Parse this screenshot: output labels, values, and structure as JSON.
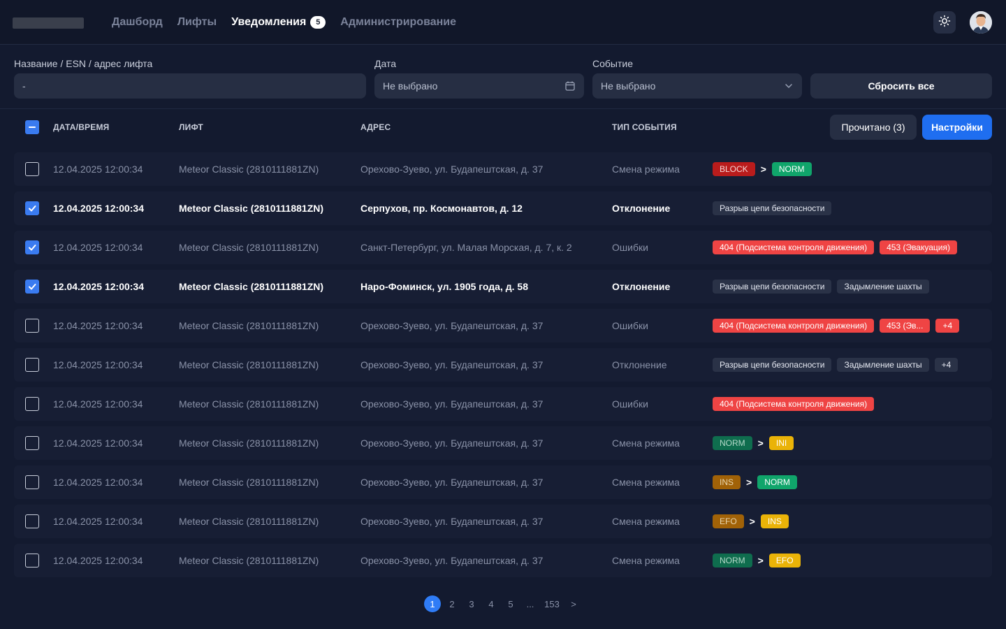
{
  "nav": {
    "items": [
      {
        "label": "Дашборд",
        "active": false
      },
      {
        "label": "Лифты",
        "active": false
      },
      {
        "label": "Уведомления",
        "active": true,
        "badge": "5"
      },
      {
        "label": "Администрирование",
        "active": false
      }
    ],
    "theme_icon": "sun-icon"
  },
  "filters": {
    "search_label": "Название / ESN / адрес лифта",
    "search_value": "-",
    "date_label": "Дата",
    "date_value": "Не выбрано",
    "event_label": "Событие",
    "event_value": "Не выбрано",
    "reset_label": "Сбросить все"
  },
  "table": {
    "headers": {
      "date": "ДАТА/ВРЕМЯ",
      "lift": "ЛИФТ",
      "address": "АДРЕС",
      "type": "ТИП СОБЫТИЯ"
    },
    "read_button": "Прочитано (3)",
    "settings_button": "Настройки",
    "rows": [
      {
        "checked": false,
        "bold": false,
        "date": "12.04.2025 12:00:34",
        "lift": "Meteor Classic (2810111881ZN)",
        "address": "Орехово-Зуево, ул. Будапештская, д. 37",
        "type": "Смена режима",
        "tags": [
          {
            "text": "BLOCK",
            "color": "darkred"
          },
          {
            "arrow": ">"
          },
          {
            "text": "NORM",
            "color": "green"
          }
        ]
      },
      {
        "checked": true,
        "bold": true,
        "date": "12.04.2025 12:00:34",
        "lift": "Meteor Classic (2810111881ZN)",
        "address": "Серпухов, пр. Космонавтов, д. 12",
        "type": "Отклонение",
        "tags": [
          {
            "text": "Разрыв цепи безопасности",
            "color": "gray"
          }
        ]
      },
      {
        "checked": true,
        "bold": false,
        "date": "12.04.2025 12:00:34",
        "lift": "Meteor Classic (2810111881ZN)",
        "address": "Санкт-Петербург, ул. Малая Морская, д. 7, к. 2",
        "type": "Ошибки",
        "tags": [
          {
            "text": "404 (Подсистема контроля движения)",
            "color": "red"
          },
          {
            "text": "453 (Эвакуация)",
            "color": "red"
          }
        ]
      },
      {
        "checked": true,
        "bold": true,
        "date": "12.04.2025 12:00:34",
        "lift": "Meteor Classic (2810111881ZN)",
        "address": "Наро-Фоминск, ул. 1905 года, д. 58",
        "type": "Отклонение",
        "tags": [
          {
            "text": "Разрыв цепи безопасности",
            "color": "gray"
          },
          {
            "text": "Задымление шахты",
            "color": "gray"
          }
        ]
      },
      {
        "checked": false,
        "bold": false,
        "date": "12.04.2025 12:00:34",
        "lift": "Meteor Classic (2810111881ZN)",
        "address": "Орехово-Зуево, ул. Будапештская, д. 37",
        "type": "Ошибки",
        "tags": [
          {
            "text": "404 (Подсистема контроля движения)",
            "color": "red"
          },
          {
            "text": "453 (Эв...",
            "color": "red"
          },
          {
            "text": "+4",
            "color": "red"
          }
        ]
      },
      {
        "checked": false,
        "bold": false,
        "date": "12.04.2025 12:00:34",
        "lift": "Meteor Classic (2810111881ZN)",
        "address": "Орехово-Зуево, ул. Будапештская, д. 37",
        "type": "Отклонение",
        "tags": [
          {
            "text": "Разрыв цепи безопасности",
            "color": "gray"
          },
          {
            "text": "Задымление шахты",
            "color": "gray"
          },
          {
            "text": "+4",
            "color": "gray"
          }
        ]
      },
      {
        "checked": false,
        "bold": false,
        "date": "12.04.2025 12:00:34",
        "lift": "Meteor Classic (2810111881ZN)",
        "address": "Орехово-Зуево, ул. Будапештская, д. 37",
        "type": "Ошибки",
        "tags": [
          {
            "text": "404 (Подсистема контроля движения)",
            "color": "red"
          }
        ]
      },
      {
        "checked": false,
        "bold": false,
        "date": "12.04.2025 12:00:34",
        "lift": "Meteor Classic (2810111881ZN)",
        "address": "Орехово-Зуево, ул. Будапештская, д. 37",
        "type": "Смена режима",
        "tags": [
          {
            "text": "NORM",
            "color": "darkgreen"
          },
          {
            "arrow": ">"
          },
          {
            "text": "INI",
            "color": "yellow"
          }
        ]
      },
      {
        "checked": false,
        "bold": false,
        "date": "12.04.2025 12:00:34",
        "lift": "Meteor Classic (2810111881ZN)",
        "address": "Орехово-Зуево, ул. Будапештская, д. 37",
        "type": "Смена режима",
        "tags": [
          {
            "text": "INS",
            "color": "darkyellow"
          },
          {
            "arrow": ">"
          },
          {
            "text": "NORM",
            "color": "green"
          }
        ]
      },
      {
        "checked": false,
        "bold": false,
        "date": "12.04.2025 12:00:34",
        "lift": "Meteor Classic (2810111881ZN)",
        "address": "Орехово-Зуево, ул. Будапештская, д. 37",
        "type": "Смена режима",
        "tags": [
          {
            "text": "EFO",
            "color": "darkyellow"
          },
          {
            "arrow": ">"
          },
          {
            "text": "INS",
            "color": "yellow"
          }
        ]
      },
      {
        "checked": false,
        "bold": false,
        "date": "12.04.2025 12:00:34",
        "lift": "Meteor Classic (2810111881ZN)",
        "address": "Орехово-Зуево, ул. Будапештская, д. 37",
        "type": "Смена режима",
        "tags": [
          {
            "text": "NORM",
            "color": "darkgreen"
          },
          {
            "arrow": ">"
          },
          {
            "text": "EFO",
            "color": "yellow"
          }
        ]
      }
    ]
  },
  "pagination": {
    "pages": [
      "1",
      "2",
      "3",
      "4",
      "5",
      "...",
      "153",
      ">"
    ],
    "current": "1"
  },
  "colors": {
    "background": "#131a2f",
    "accent": "#1f6ef0",
    "row_background": "#171e34"
  }
}
